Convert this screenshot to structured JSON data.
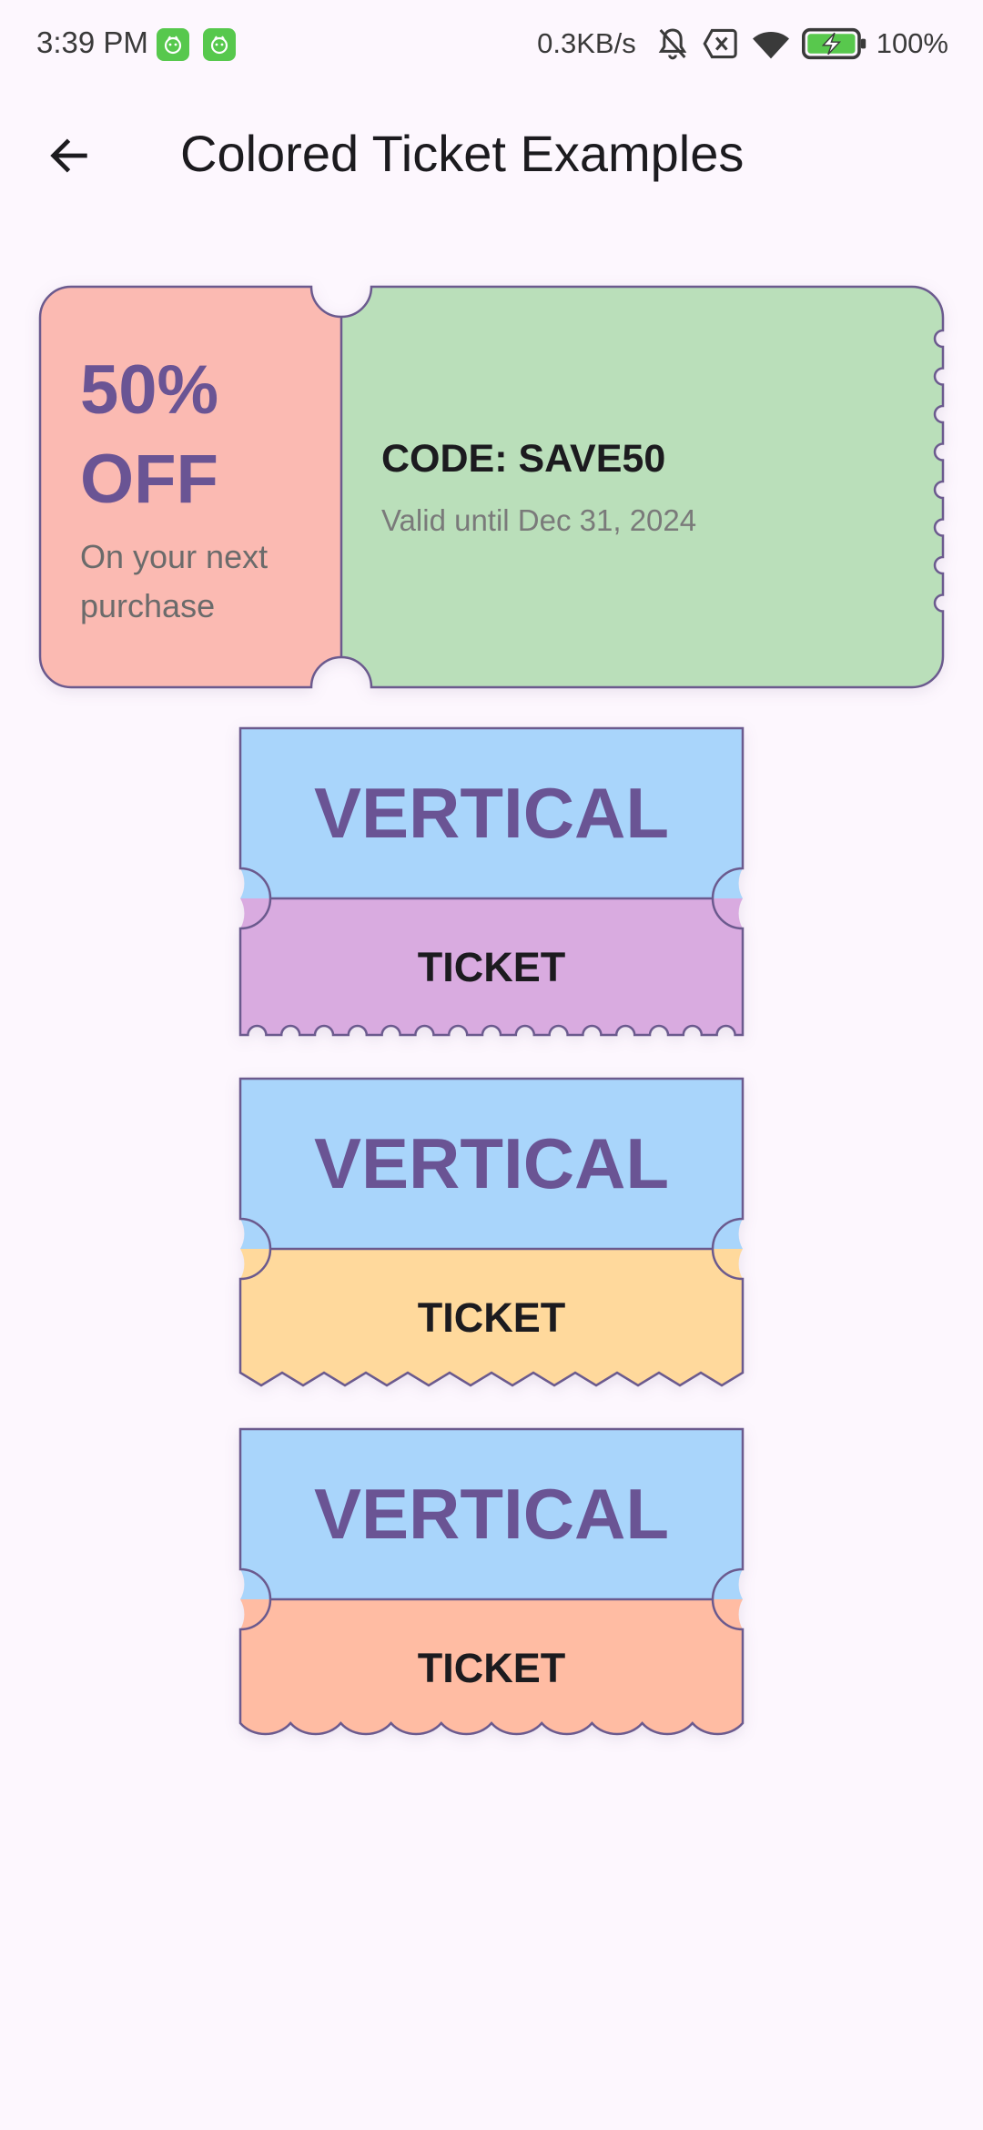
{
  "status_bar": {
    "time": "3:39 PM",
    "network_speed": "0.3KB/s",
    "battery_percent": "100%",
    "icons": [
      "app-notification-icon",
      "app-notification-icon",
      "mute-bell-icon",
      "sim-off-icon",
      "wifi-icon",
      "battery-charging-icon"
    ]
  },
  "app_bar": {
    "back_icon": "arrow-left-icon",
    "title": "Colored Ticket Examples"
  },
  "coupon_ticket": {
    "discount": "50% OFF",
    "subtitle": "On your next purchase",
    "code": "CODE: SAVE50",
    "validity": "Valid until Dec 31, 2024",
    "left_color": "#fbbab2",
    "right_color": "#badfba",
    "border_color": "#6b5a8e"
  },
  "vertical_tickets": [
    {
      "top_label": "VERTICAL",
      "bottom_label": "TICKET",
      "top_color": "#a9d5fb",
      "bottom_color": "#d9abe0",
      "edge_style": "scalloped-holes"
    },
    {
      "top_label": "VERTICAL",
      "bottom_label": "TICKET",
      "top_color": "#a9d5fb",
      "bottom_color": "#ffd99c",
      "edge_style": "zigzag"
    },
    {
      "top_label": "VERTICAL",
      "bottom_label": "TICKET",
      "top_color": "#a9d5fb",
      "bottom_color": "#ffbca3",
      "edge_style": "wave"
    }
  ],
  "colors": {
    "background": "#fdf7fe",
    "accent_text": "#6a5494",
    "border": "#6b5a8e"
  }
}
